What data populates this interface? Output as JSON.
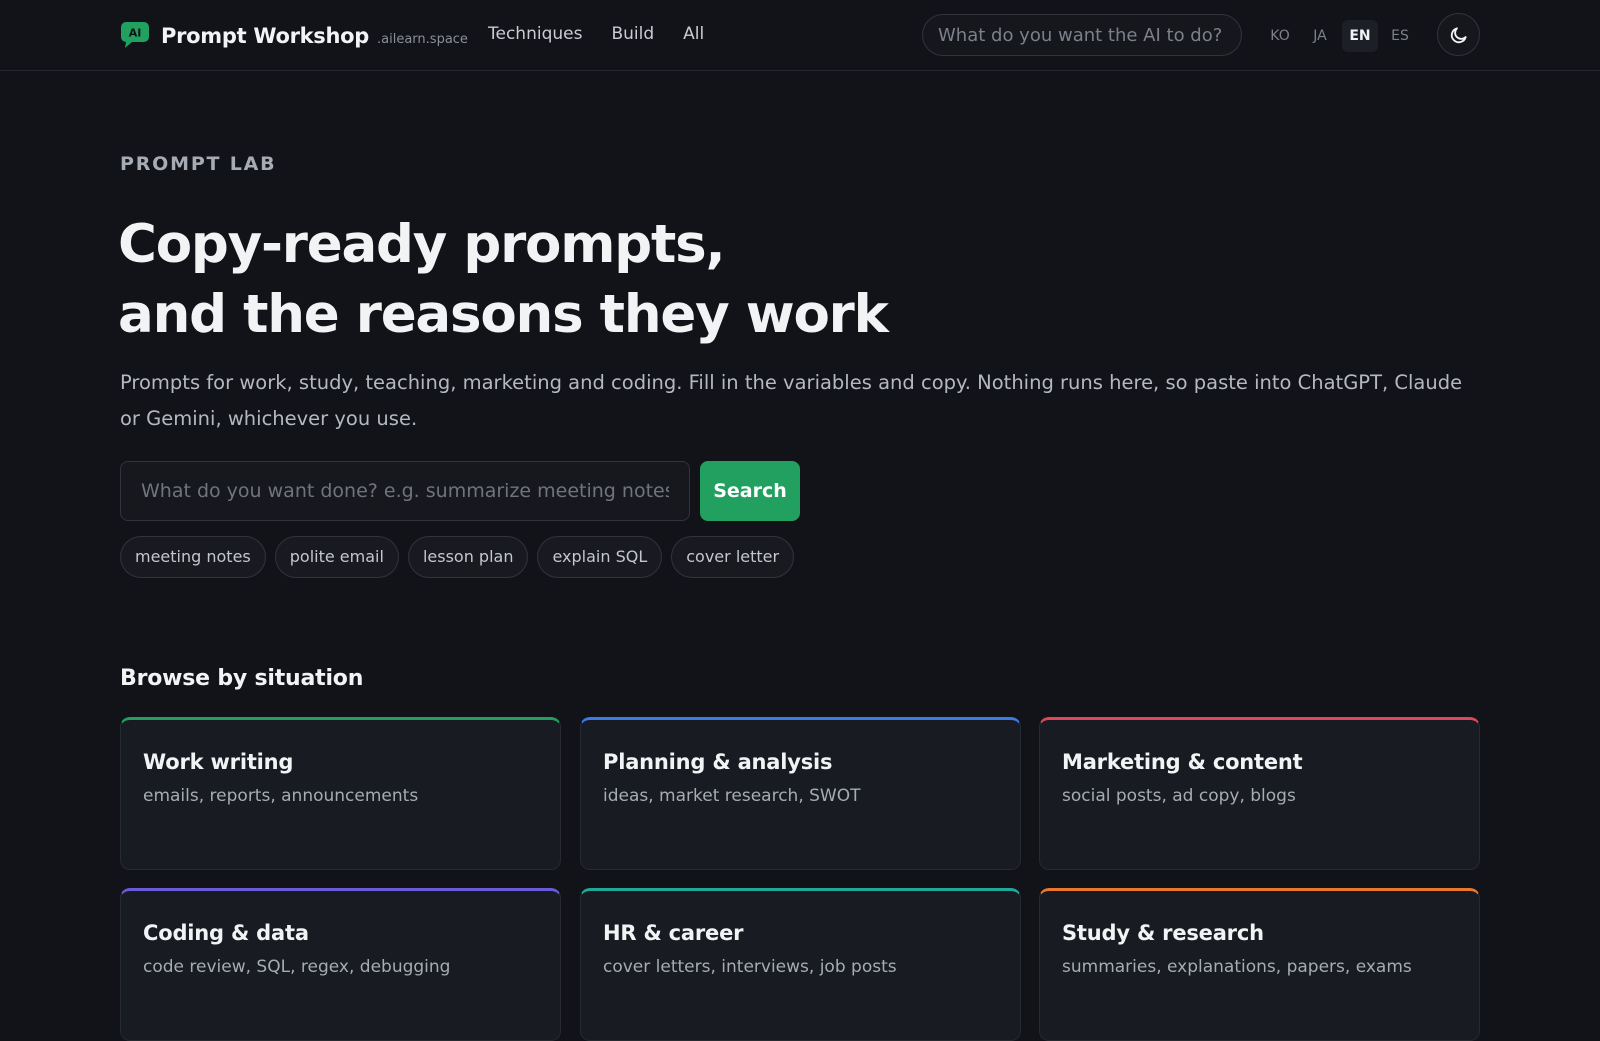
{
  "header": {
    "brand_name": "Prompt Workshop",
    "brand_domain": ".ailearn.space",
    "logo_text": "AI",
    "nav": [
      "Techniques",
      "Build",
      "All"
    ],
    "search_placeholder": "What do you want the AI to do?",
    "languages": [
      "KO",
      "JA",
      "EN",
      "ES"
    ],
    "active_language": "EN",
    "theme_icon": "moon-icon"
  },
  "hero": {
    "eyebrow": "PROMPT LAB",
    "title_line1": "Copy-ready prompts,",
    "title_line2": "and the reasons they work",
    "description": "Prompts for work, study, teaching, marketing and coding. Fill in the variables and copy. Nothing runs here, so paste into ChatGPT, Claude or Gemini, whichever you use.",
    "search_placeholder": "What do you want done? e.g. summarize meeting notes",
    "search_button": "Search",
    "chips": [
      "meeting notes",
      "polite email",
      "lesson plan",
      "explain SQL",
      "cover letter"
    ]
  },
  "browse": {
    "title": "Browse by situation",
    "cards": [
      {
        "title": "Work writing",
        "subtitle": "emails, reports, announcements",
        "accent": "#22a060"
      },
      {
        "title": "Planning & analysis",
        "subtitle": "ideas, market research, SWOT",
        "accent": "#3b7ae8"
      },
      {
        "title": "Marketing & content",
        "subtitle": "social posts, ad copy, blogs",
        "accent": "#e0485a"
      },
      {
        "title": "Coding & data",
        "subtitle": "code review, SQL, regex, debugging",
        "accent": "#6a5cd8"
      },
      {
        "title": "HR & career",
        "subtitle": "cover letters, interviews, job posts",
        "accent": "#1fa99a"
      },
      {
        "title": "Study & research",
        "subtitle": "summaries, explanations, papers, exams",
        "accent": "#e8782a"
      }
    ]
  },
  "colors": {
    "background": "#111318",
    "primary": "#22a060"
  }
}
